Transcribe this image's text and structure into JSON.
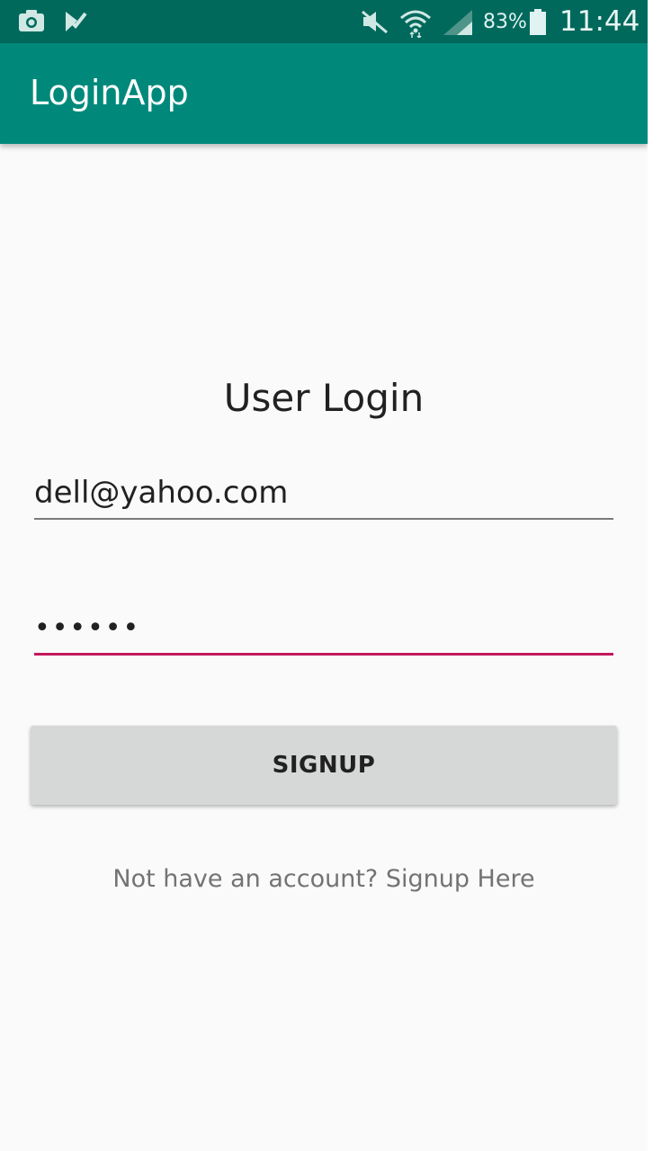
{
  "status_bar": {
    "icons_left": [
      "camera-icon",
      "download-check-icon"
    ],
    "icons_right": [
      "mute-icon",
      "wifi-icon",
      "signal-icon",
      "battery-icon"
    ],
    "battery_percent": "83%",
    "time": "11:44"
  },
  "app_bar": {
    "title": "LoginApp"
  },
  "login": {
    "title": "User Login",
    "email_value": "dell@yahoo.com",
    "password_value": "••••••",
    "signup_button": "SIGNUP",
    "signup_link": "Not have an account? Signup Here"
  },
  "colors": {
    "status_bar": "#00695c",
    "app_bar": "#00897b",
    "accent": "#c2185b",
    "button": "#d6d7d7",
    "background": "#fafafa"
  }
}
